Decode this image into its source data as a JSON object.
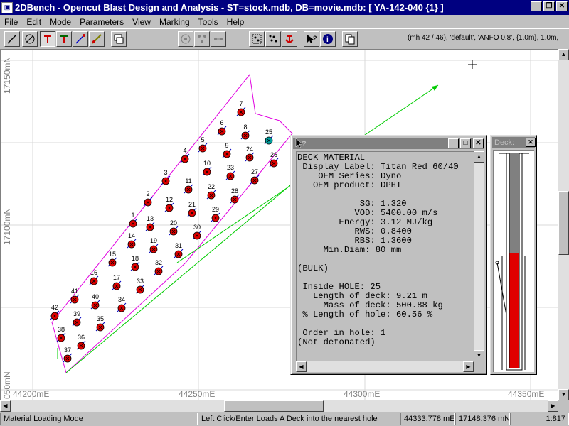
{
  "window": {
    "title": "2DBench - Opencut Blast Design and Analysis - ST=stock.mdb, DB=movie.mdb: [ YA-142-040 {1} ]",
    "minimize": "_",
    "restore": "❐",
    "close": "✕"
  },
  "menu": [
    {
      "label": "File",
      "key": "F",
      "rest": "ile"
    },
    {
      "label": "Edit",
      "key": "E",
      "rest": "dit"
    },
    {
      "label": "Mode",
      "key": "M",
      "rest": "ode"
    },
    {
      "label": "Parameters",
      "key": "P",
      "rest": "arameters"
    },
    {
      "label": "View",
      "key": "V",
      "rest": "iew"
    },
    {
      "label": "Marking",
      "key": "M",
      "rest": "arking"
    },
    {
      "label": "Tools",
      "key": "T",
      "rest": "ools"
    },
    {
      "label": "Help",
      "key": "H",
      "rest": "elp"
    }
  ],
  "toolbar_info": "(mh 42 / 46), 'default', 'ANFO 0.8', {1.0m}, 1.0m,",
  "axis_labels": {
    "y1": "17150mN",
    "y2": "17100mN",
    "y3": "050mN",
    "x1": "44200mE",
    "x2": "44250mE",
    "x3": "44300mE",
    "x4": "44350mE"
  },
  "holes": [
    "1",
    "2",
    "3",
    "4",
    "5",
    "6",
    "7",
    "8",
    "9",
    "10",
    "11",
    "12",
    "13",
    "14",
    "15",
    "16",
    "17",
    "18",
    "19",
    "20",
    "21",
    "22",
    "23",
    "24",
    "25",
    "26",
    "27",
    "28",
    "29",
    "30",
    "31",
    "32",
    "33",
    "34",
    "35",
    "36",
    "37",
    "38",
    "39",
    "40",
    "41",
    "42"
  ],
  "deck_window": {
    "lines": [
      "DECK MATERIAL",
      " Display Label: Titan Red 60/40",
      "    OEM Series: Dyno",
      "   OEM product: DPHI",
      "",
      "            SG: 1.320",
      "           VOD: 5400.00 m/s",
      "        Energy: 3.12 MJ/kg",
      "           RWS: 0.8400",
      "           RBS: 1.3600",
      "     Min.Diam: 80 mm",
      "",
      "(BULK)",
      "",
      " Inside HOLE: 25",
      "   Length of deck: 9.21 m",
      "     Mass of deck: 500.88 kg",
      " % Length of hole: 60.56 %",
      "",
      " Order in hole: 1",
      "(Not detonated)"
    ],
    "help_glyph": "?",
    "min": "_",
    "max": "□",
    "close": "✕"
  },
  "side_window": {
    "title": "Deck: ",
    "close": "✕"
  },
  "status": {
    "mode": "Material Loading Mode",
    "hint": "Left Click/Enter Loads A Deck into the nearest hole",
    "east": "44333.778 mE",
    "north": "17148.376 mN",
    "scale": "1:817"
  }
}
